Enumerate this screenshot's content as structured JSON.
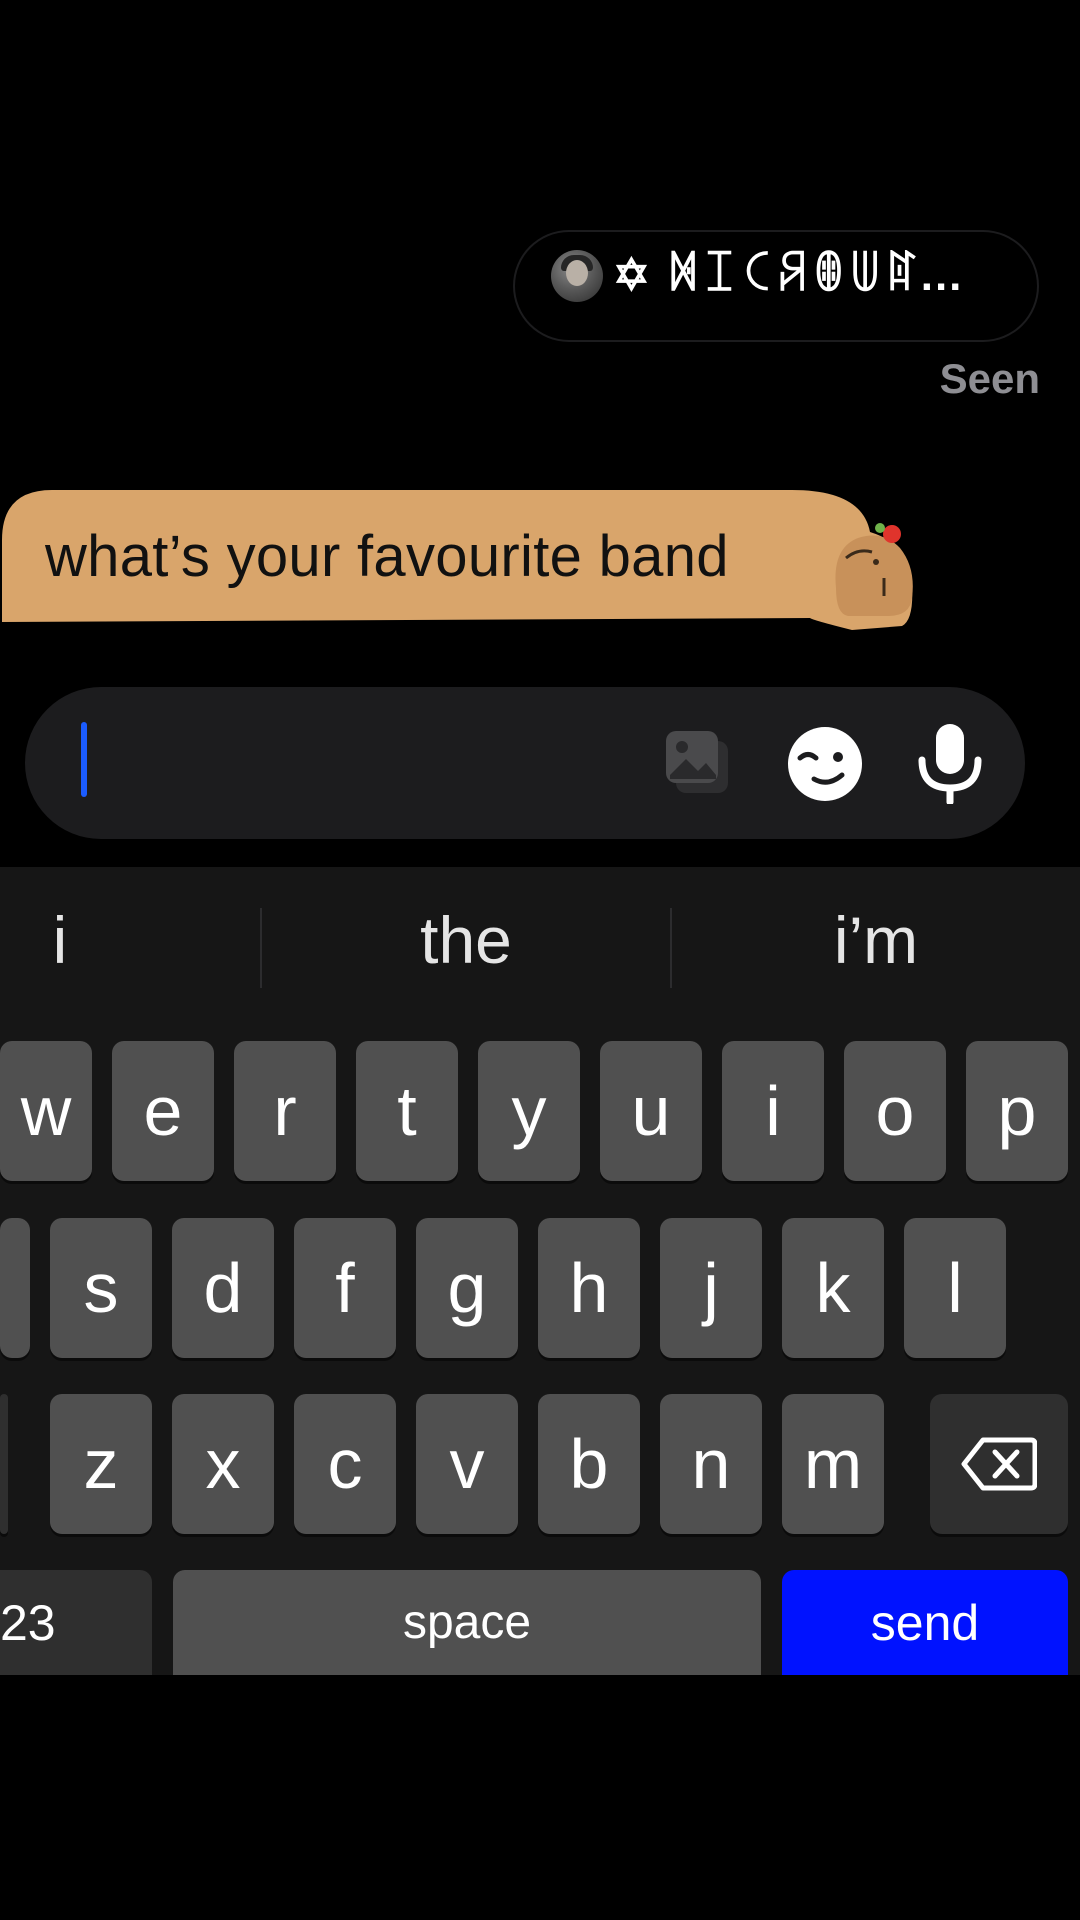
{
  "reply_preview": {
    "name": "✡ ꁒꀤꉓꋪꂦꅏꍏ...",
    "seen_label": "Seen"
  },
  "message": {
    "text": "what’s your favourite band",
    "bubble_color": "#d9a56b",
    "sticker": "capybara-icon"
  },
  "composer": {
    "value": "",
    "icons": [
      "gallery-icon",
      "sticker-face-icon",
      "microphone-icon"
    ]
  },
  "keyboard": {
    "suggestions": [
      "i",
      "the",
      "i’m"
    ],
    "row1": [
      "w",
      "e",
      "r",
      "t",
      "y",
      "u",
      "i",
      "o",
      "p"
    ],
    "row2": [
      "s",
      "d",
      "f",
      "g",
      "h",
      "j",
      "k",
      "l"
    ],
    "row3": [
      "z",
      "x",
      "c",
      "v",
      "b",
      "n",
      "m"
    ],
    "numbers_label": "23",
    "space_label": "space",
    "send_label": "send",
    "send_color": "#0012ff",
    "icons": [
      "backspace-icon"
    ]
  }
}
